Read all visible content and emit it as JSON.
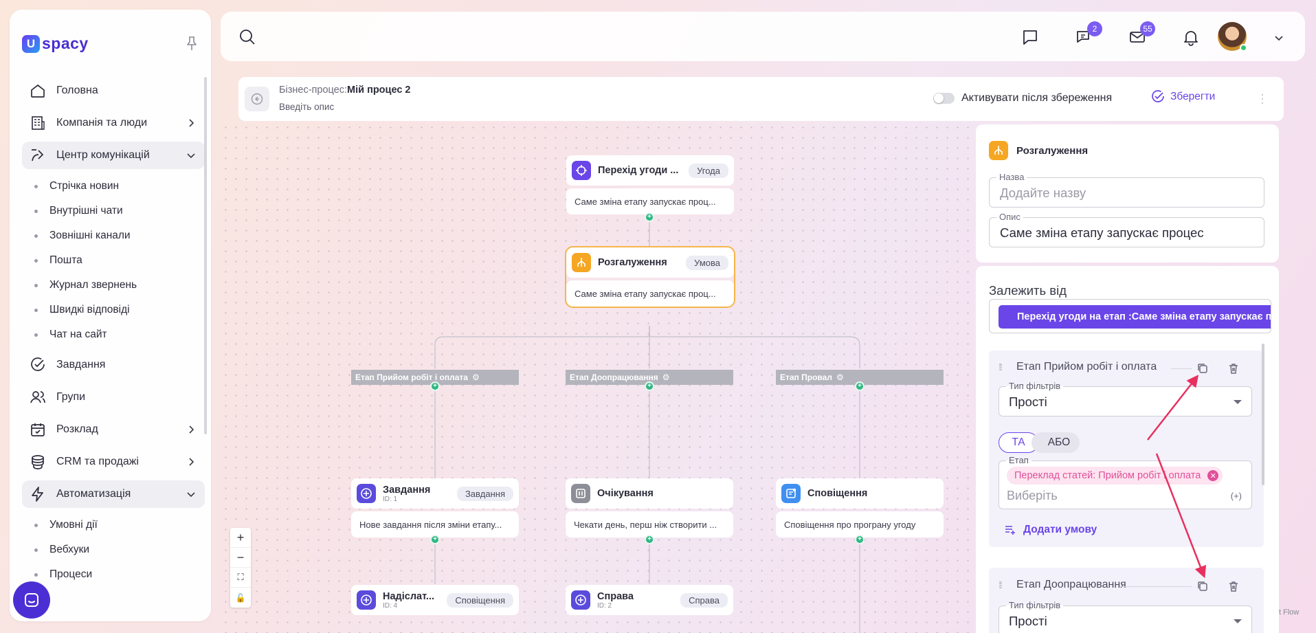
{
  "app": {
    "logo_letter": "U",
    "logo_word": "spacy"
  },
  "sidebar": {
    "items": [
      {
        "label": "Головна",
        "icon": "home-icon"
      },
      {
        "label": "Компанія та люди",
        "icon": "building-icon"
      },
      {
        "label": "Центр комунікацій",
        "icon": "communication-icon"
      },
      {
        "label": "Завдання",
        "icon": "check-circle-icon"
      },
      {
        "label": "Групи",
        "icon": "users-icon"
      },
      {
        "label": "Розклад",
        "icon": "calendar-icon"
      },
      {
        "label": "CRM та продажі",
        "icon": "coins-icon"
      },
      {
        "label": "Автоматизація",
        "icon": "lightning-icon"
      }
    ],
    "communication_sub": [
      "Стрічка новин",
      "Внутрішні чати",
      "Зовнішні канали",
      "Пошта",
      "Журнал звернень",
      "Швидкі відповіді",
      "Чат на сайт"
    ],
    "automation_sub": [
      "Умовні дії",
      "Вебхуки",
      "Процеси"
    ]
  },
  "topbar": {
    "chats_badge": "2",
    "mail_badge": "55"
  },
  "process": {
    "prefix": "Бізнес-процес:",
    "name": "Мій процес 2",
    "description": "Введіть опис",
    "toggle_label": "Активувати після збереження",
    "toggle_on": false,
    "save_label": "Зберегти"
  },
  "flow": {
    "trigger": {
      "title": "Перехід угоди ...",
      "tag": "Угода",
      "body": "Саме зміна етапу запускає проц..."
    },
    "branch": {
      "title": "Розгалуження",
      "tag": "Умова",
      "body": "Саме зміна етапу запускає проц..."
    },
    "stages": [
      "Етап Прийом робіт і оплата",
      "Етап Доопрацювання",
      "Етап Провал"
    ],
    "task": {
      "title": "Завдання",
      "id": "ID: 1",
      "tag": "Завдання",
      "body": "Нове завдання після зміни етапу..."
    },
    "wait": {
      "title": "Очікування",
      "body": "Чекати день, перш ніж створити ..."
    },
    "notify": {
      "title": "Сповіщення",
      "body": "Сповіщення про програну угоду"
    },
    "send": {
      "title": "Надіслат...",
      "id": "ID: 4",
      "tag": "Сповіщення"
    },
    "case": {
      "title": "Справа",
      "id": "ID: 2",
      "tag": "Справа"
    }
  },
  "zoom": {
    "in": "+",
    "out": "−",
    "fit": "⛶",
    "lock": "🔓"
  },
  "attribution": "t Flow",
  "panel": {
    "title": "Розгалуження",
    "name_label": "Назва",
    "name_placeholder": "Додайте назву",
    "desc_label": "Опис",
    "desc_value": "Саме зміна етапу запускає процес",
    "depends_label": "Залежить від",
    "depends_value": "Перехід угоди на етап :Саме зміна етапу запускає процес",
    "conditions": [
      {
        "title": "Етап Прийом робіт і оплата",
        "filter_label": "Тип фільтрів",
        "filter_value": "Прості",
        "logic_and": "ТА",
        "logic_or": "АБО",
        "stage_label": "Етап",
        "chip": "Переклад статей: Прийом робіт і оплата",
        "select_placeholder": "Виберіть",
        "plus": "(+)",
        "add_condition": "Додати умову"
      },
      {
        "title": "Етап Доопрацювання",
        "filter_label": "Тип фільтрів",
        "filter_value": "Прості"
      }
    ]
  },
  "colors": {
    "accent": "#6a45e8",
    "connector": "#2fb783",
    "branch": "#f5a623",
    "annotation_arrow": "#e8305e"
  }
}
